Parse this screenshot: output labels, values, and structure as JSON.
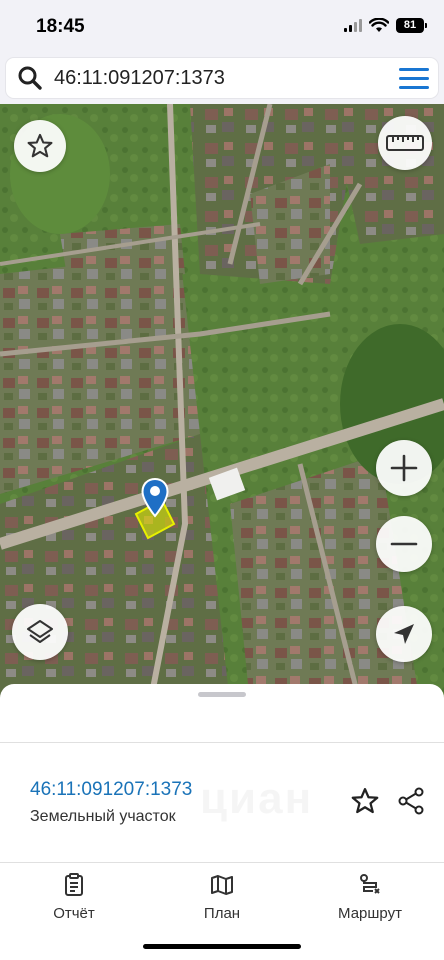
{
  "status_bar": {
    "time": "18:45",
    "battery": "81"
  },
  "search": {
    "query": "46:11:091207:1373"
  },
  "map": {
    "controls": [
      "favorite-icon",
      "ruler-icon",
      "zoom-in-icon",
      "zoom-out-icon",
      "layers-icon",
      "locate-icon"
    ]
  },
  "parcel": {
    "number": "46:11:091207:1373",
    "type": "Земельный участок",
    "watermark": "циан",
    "highlight_color": "#e8f000",
    "pin_color": "#1f6fc5"
  },
  "tabs": [
    {
      "label": "Отчёт",
      "icon": "report-icon"
    },
    {
      "label": "План",
      "icon": "map-plan-icon"
    },
    {
      "label": "Маршрут",
      "icon": "route-icon"
    }
  ],
  "colors": {
    "accent": "#1976d2",
    "link": "#1a73b8"
  }
}
